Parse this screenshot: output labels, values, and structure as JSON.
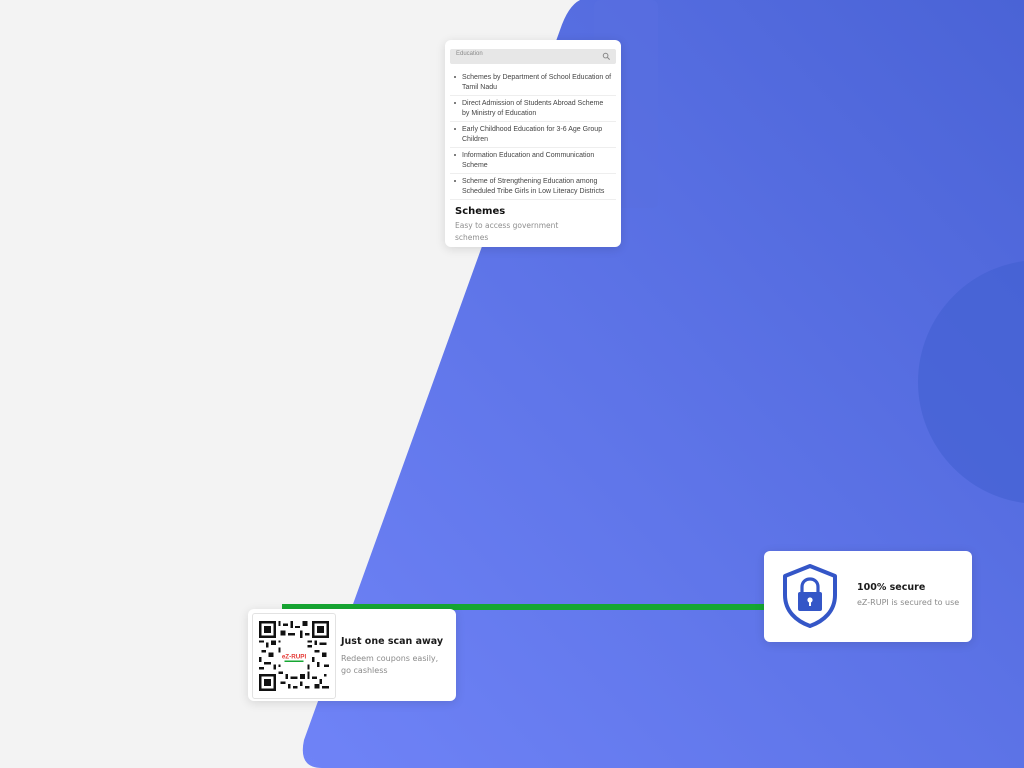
{
  "colors": {
    "page_bg": "#f3f3f3",
    "blue_start": "#6f83f7",
    "blue_end": "#4a63d6",
    "accent_green": "#16a632",
    "shield_blue": "#3456c7"
  },
  "schemes": {
    "search_value": "Education",
    "items": [
      "Schemes by Department of School Education of Tamil Nadu",
      "Direct Admission of Students Abroad Scheme by Ministry of Education",
      "Early Childhood Education for 3-6 Age Group Children",
      "Information Education and Communication Scheme",
      "Scheme of Strengthening Education among Scheduled Tribe Girls in Low Literacy Districts"
    ],
    "title": "Schemes",
    "description": "Easy to access government schemes"
  },
  "scan": {
    "title": "Just one scan away",
    "description": "Redeem coupons  easily, go cashless",
    "qr_logo_text": "eZ-RUPI"
  },
  "secure": {
    "title": "100% secure",
    "description": "eZ-RUPI is secured to use",
    "icon": "shield-lock-icon"
  }
}
